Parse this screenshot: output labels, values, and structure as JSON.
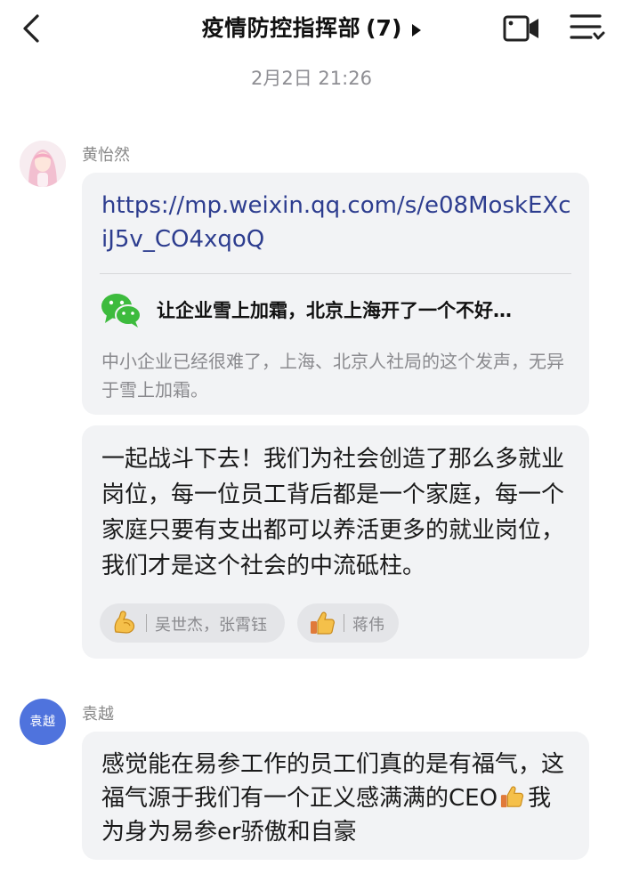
{
  "header": {
    "title": "疫情防控指挥部",
    "member_count": "(7)",
    "back_icon": "chevron-left-icon",
    "video_icon": "video-camera-icon",
    "menu_icon": "menu-icon"
  },
  "timestamp": "2月2日 21:26",
  "messages": [
    {
      "sender": "黄怡然",
      "type": "link",
      "url": "https://mp.weixin.qq.com/s/e08MoskEXciJ5v_CO4xqoQ",
      "card_title": "让企业雪上加霜，北京上海开了一个不好…",
      "card_desc": "中小企业已经很难了，上海、北京人社局的这个发声，无异于雪上加霜。",
      "card_icon": "wechat-icon"
    },
    {
      "sender": "黄怡然",
      "type": "text",
      "text": "一起战斗下去！我们为社会创造了那么多就业岗位，每一位员工背后都是一个家庭，每一个家庭只要有支出都可以养活更多的就业岗位，我们才是这个社会的中流砥柱。",
      "reactions": [
        {
          "icon": "flexed-biceps-icon",
          "names": "吴世杰，张霄钰"
        },
        {
          "icon": "thumbs-up-icon",
          "names": "蒋伟"
        }
      ]
    },
    {
      "sender": "袁越",
      "avatar_text": "袁越",
      "type": "text",
      "text_before": "感觉能在易参工作的员工们真的是有福气，这福气源于我们有一个正义感满满的CEO",
      "text_after": "我为身为易参er骄傲和自豪"
    }
  ],
  "colors": {
    "link": "#2d3d8f",
    "bubble": "#f2f3f5",
    "avatar_blue": "#4f73dd",
    "wechat_green": "#3dbb3d"
  }
}
